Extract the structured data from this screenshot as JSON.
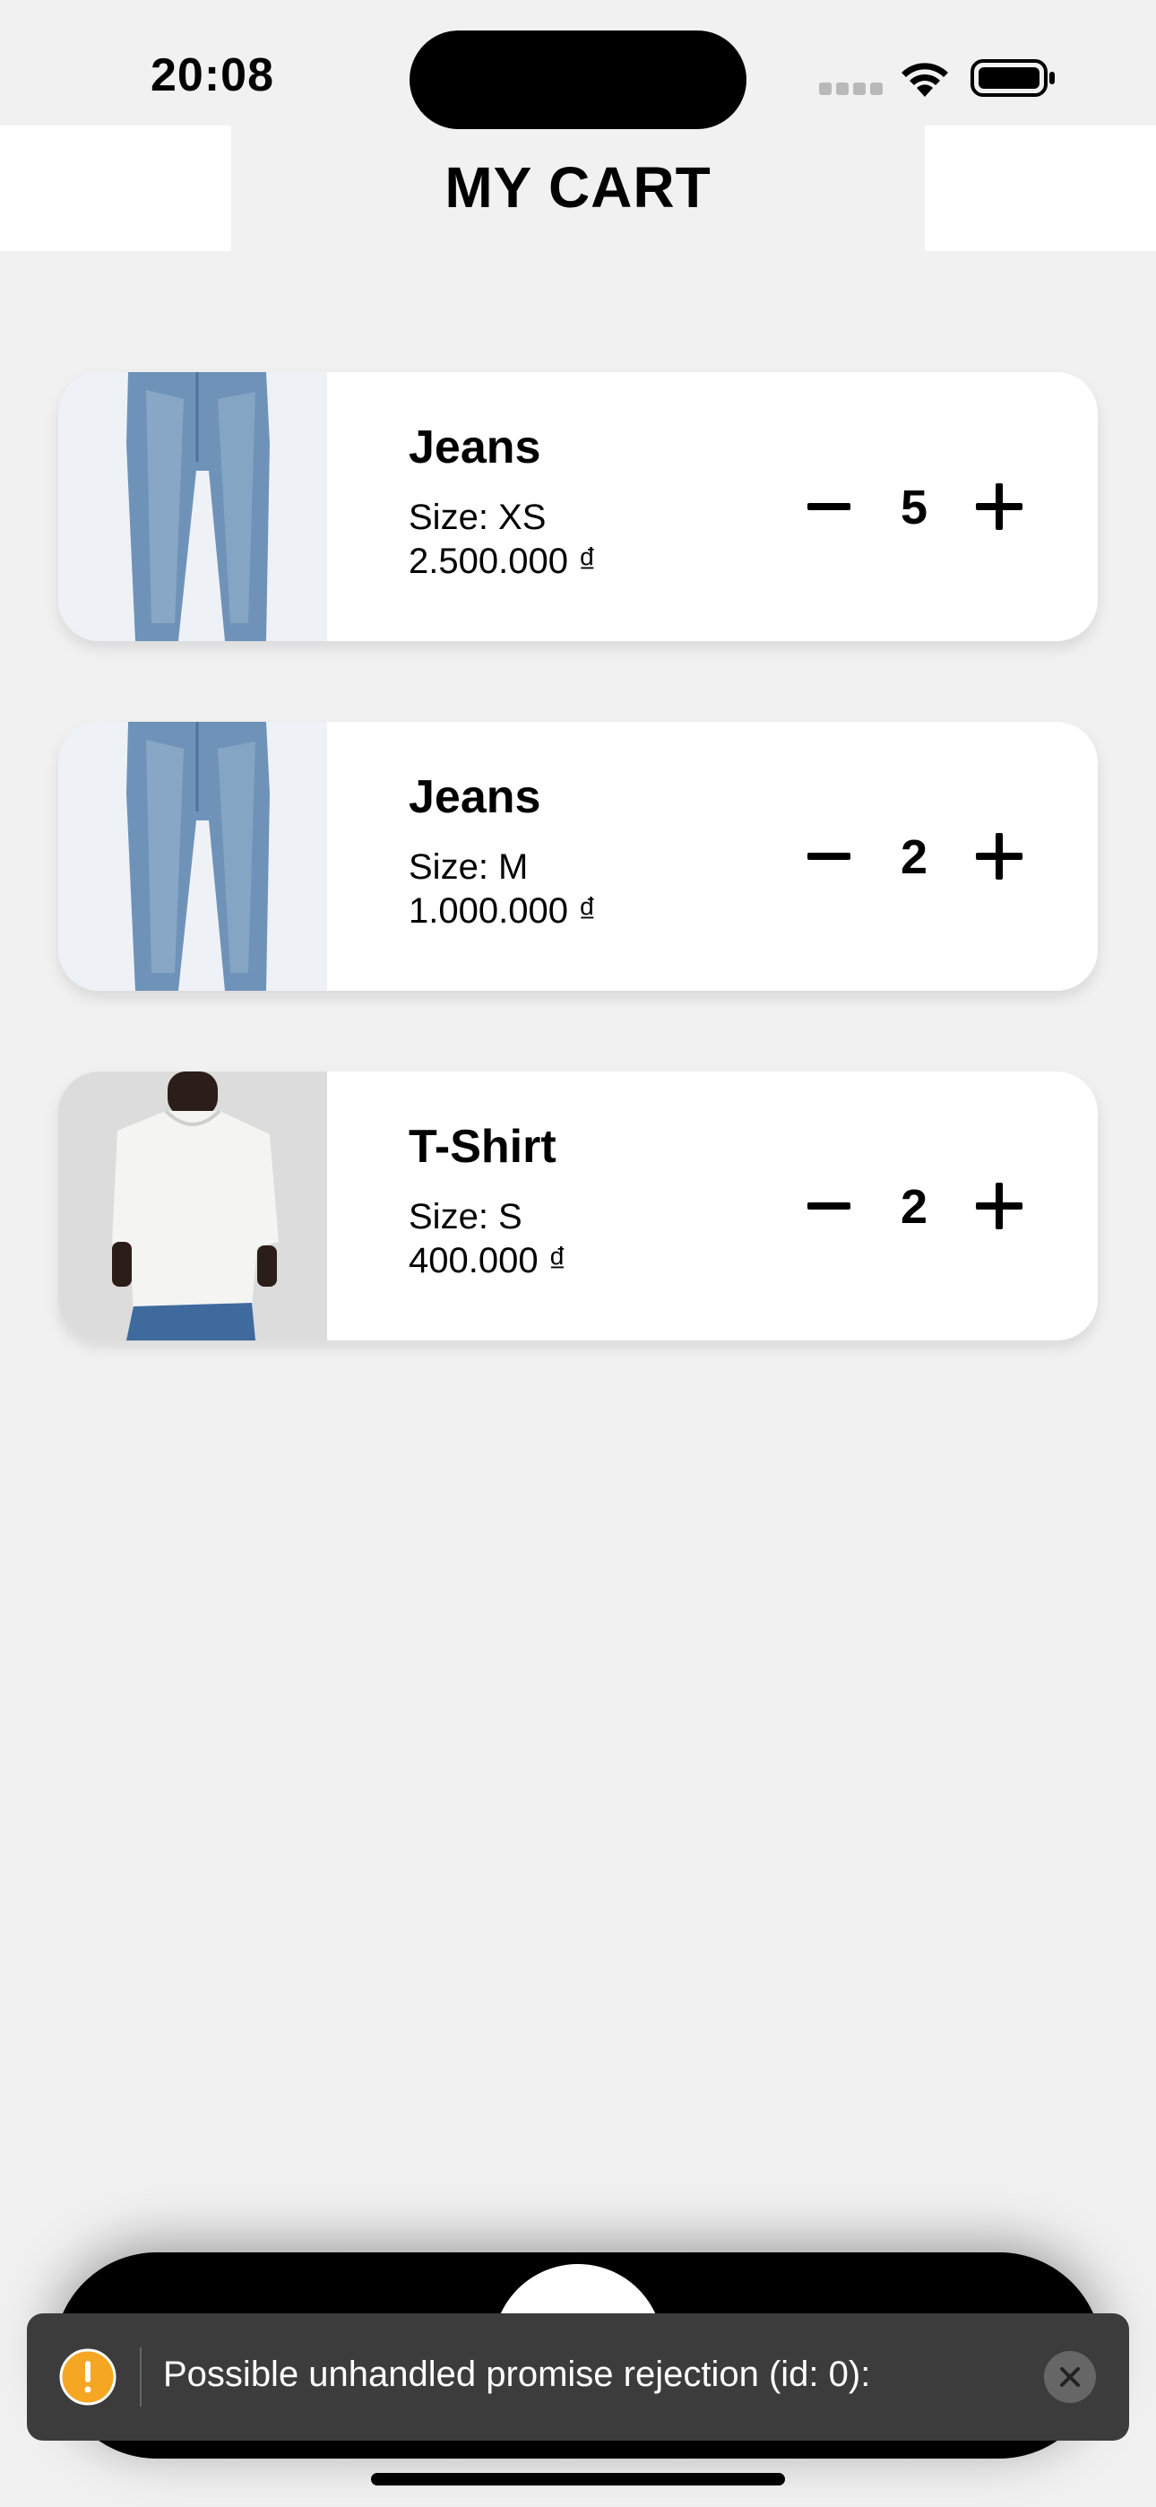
{
  "status_bar": {
    "time": "20:08",
    "icons": [
      "cellular-signal-icon",
      "wifi-icon",
      "battery-icon"
    ]
  },
  "header": {
    "title": "MY CART"
  },
  "cart_items": [
    {
      "name": "Jeans",
      "size": "Size: XS",
      "price": "2.500.000 ₫",
      "quantity": "5",
      "image": "jeans-image"
    },
    {
      "name": "Jeans",
      "size": "Size: M",
      "price": "1.000.000 ₫",
      "quantity": "2",
      "image": "jeans-image"
    },
    {
      "name": "T-Shirt",
      "size": "Size: S",
      "price": "400.000 ₫",
      "quantity": "2",
      "image": "tshirt-image"
    }
  ],
  "toast": {
    "message": "Possible unhandled promise rejection (id: 0):",
    "icon": "warning-icon",
    "close_icon": "close-icon"
  },
  "colors": {
    "background": "#f1f1f1",
    "card": "#ffffff",
    "tab_bar": "#000000",
    "toast_bg": "#3c3c3c",
    "warning": "#f5a623"
  }
}
